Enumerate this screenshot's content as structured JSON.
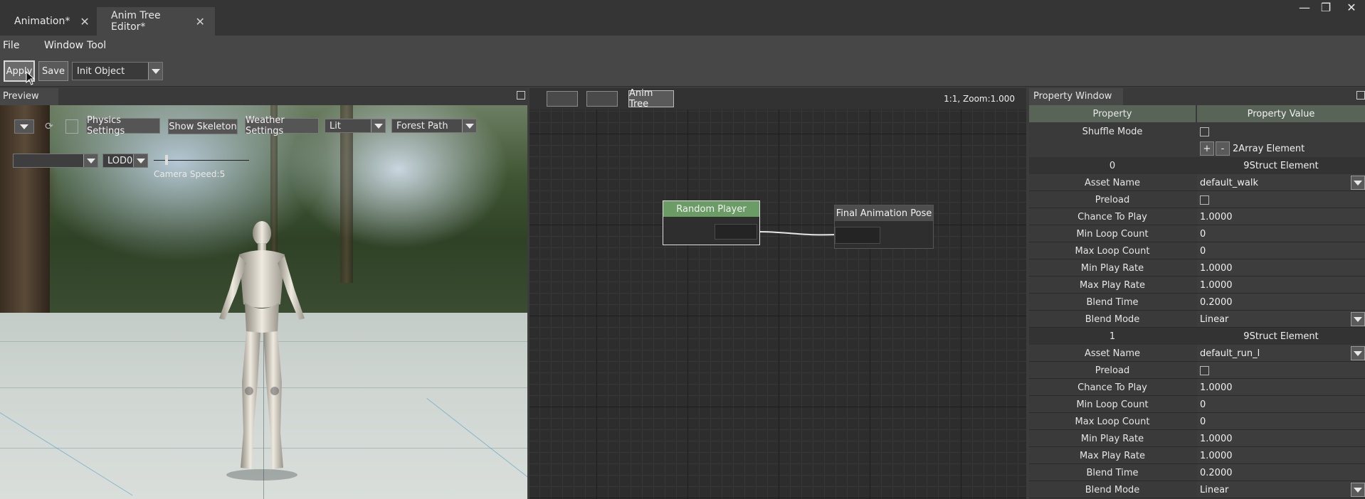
{
  "tabs": [
    {
      "label": "Animation*",
      "active": false
    },
    {
      "label": "Anim Tree Editor*",
      "active": true
    }
  ],
  "window_controls": {
    "minimize": "—",
    "restore": "❐",
    "close": "✕"
  },
  "menu": [
    "File",
    "Window",
    "Tool"
  ],
  "toolbar": {
    "apply": "Apply",
    "save": "Save",
    "init_object": "Init Object"
  },
  "preview": {
    "title": "Preview",
    "physics_settings": "Physics Settings",
    "show_skeleton": "Show Skeleton",
    "weather_settings": "Weather Settings",
    "lighting_mode": "Lit",
    "environment": "Forest Path",
    "lod": "LOD0",
    "camera_speed": "Camera Speed:5"
  },
  "graph": {
    "tab_label": "Anim Tree",
    "zoom_info": "1:1, Zoom:1.000",
    "nodes": {
      "random_player": "Random Player",
      "final_pose": "Final Animation Pose"
    }
  },
  "property_window": {
    "title": "Property Window",
    "header": {
      "name": "Property",
      "value": "Property Value"
    },
    "shuffle_label": "Shuffle Mode",
    "array_plus": "+",
    "array_minus": "-",
    "array_element": "2Array Element",
    "elements": [
      {
        "index": "0",
        "kind": "9Struct Element",
        "rows": [
          {
            "name": "Asset Name",
            "value": "default_walk",
            "type": "dropdown"
          },
          {
            "name": "Preload",
            "value": "",
            "type": "checkbox"
          },
          {
            "name": "Chance To Play",
            "value": "1.0000",
            "type": "text"
          },
          {
            "name": "Min Loop Count",
            "value": "0",
            "type": "text"
          },
          {
            "name": "Max Loop Count",
            "value": "0",
            "type": "text"
          },
          {
            "name": "Min Play Rate",
            "value": "1.0000",
            "type": "text"
          },
          {
            "name": "Max Play Rate",
            "value": "1.0000",
            "type": "text"
          },
          {
            "name": "Blend Time",
            "value": "0.2000",
            "type": "text"
          },
          {
            "name": "Blend Mode",
            "value": "Linear",
            "type": "dropdown"
          }
        ]
      },
      {
        "index": "1",
        "kind": "9Struct Element",
        "rows": [
          {
            "name": "Asset Name",
            "value": "default_run_l",
            "type": "dropdown"
          },
          {
            "name": "Preload",
            "value": "",
            "type": "checkbox"
          },
          {
            "name": "Chance To Play",
            "value": "1.0000",
            "type": "text"
          },
          {
            "name": "Min Loop Count",
            "value": "0",
            "type": "text"
          },
          {
            "name": "Max Loop Count",
            "value": "0",
            "type": "text"
          },
          {
            "name": "Min Play Rate",
            "value": "1.0000",
            "type": "text"
          },
          {
            "name": "Max Play Rate",
            "value": "1.0000",
            "type": "text"
          },
          {
            "name": "Blend Time",
            "value": "0.2000",
            "type": "text"
          },
          {
            "name": "Blend Mode",
            "value": "Linear",
            "type": "dropdown"
          }
        ]
      }
    ]
  },
  "colors": {
    "node_header_green": "#6b9c66",
    "prop_header": "#586458",
    "panel_bg": "#3a3a3a"
  }
}
